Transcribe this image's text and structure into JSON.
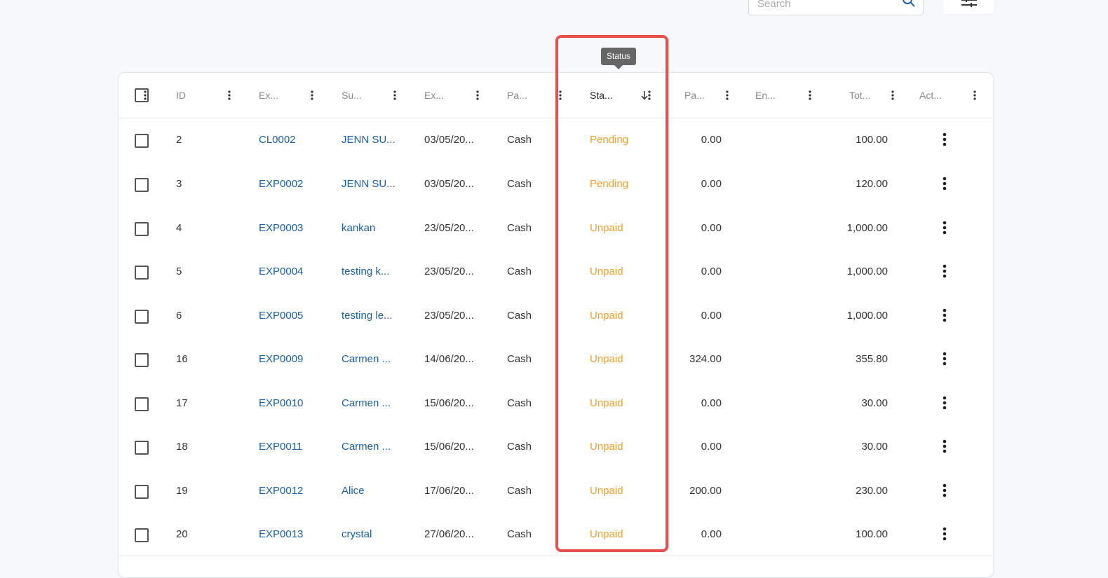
{
  "search": {
    "placeholder": "Search"
  },
  "tooltip": {
    "text": "Status"
  },
  "columns": [
    {
      "label": "ID"
    },
    {
      "label": "Ex..."
    },
    {
      "label": "Su..."
    },
    {
      "label": "Ex..."
    },
    {
      "label": "Pa..."
    },
    {
      "label": "Sta...",
      "sorted": "desc"
    },
    {
      "label": "Pa..."
    },
    {
      "label": "En..."
    },
    {
      "label": "Tot..."
    },
    {
      "label": "Act..."
    }
  ],
  "rows": [
    {
      "id": "2",
      "expense_no": "CL0002",
      "supplier": "JENN SU...",
      "date": "03/05/20...",
      "payment": "Cash",
      "status": "Pending",
      "paid": "0.00",
      "entity": "",
      "total": "100.00"
    },
    {
      "id": "3",
      "expense_no": "EXP0002",
      "supplier": "JENN SU...",
      "date": "03/05/20...",
      "payment": "Cash",
      "status": "Pending",
      "paid": "0.00",
      "entity": "",
      "total": "120.00"
    },
    {
      "id": "4",
      "expense_no": "EXP0003",
      "supplier": "kankan",
      "date": "23/05/20...",
      "payment": "Cash",
      "status": "Unpaid",
      "paid": "0.00",
      "entity": "",
      "total": "1,000.00"
    },
    {
      "id": "5",
      "expense_no": "EXP0004",
      "supplier": "testing k...",
      "date": "23/05/20...",
      "payment": "Cash",
      "status": "Unpaid",
      "paid": "0.00",
      "entity": "",
      "total": "1,000.00"
    },
    {
      "id": "6",
      "expense_no": "EXP0005",
      "supplier": "testing le...",
      "date": "23/05/20...",
      "payment": "Cash",
      "status": "Unpaid",
      "paid": "0.00",
      "entity": "",
      "total": "1,000.00"
    },
    {
      "id": "16",
      "expense_no": "EXP0009",
      "supplier": "Carmen ...",
      "date": "14/06/20...",
      "payment": "Cash",
      "status": "Unpaid",
      "paid": "324.00",
      "entity": "",
      "total": "355.80"
    },
    {
      "id": "17",
      "expense_no": "EXP0010",
      "supplier": "Carmen ...",
      "date": "15/06/20...",
      "payment": "Cash",
      "status": "Unpaid",
      "paid": "0.00",
      "entity": "",
      "total": "30.00"
    },
    {
      "id": "18",
      "expense_no": "EXP0011",
      "supplier": "Carmen ...",
      "date": "15/06/20...",
      "payment": "Cash",
      "status": "Unpaid",
      "paid": "0.00",
      "entity": "",
      "total": "30.00"
    },
    {
      "id": "19",
      "expense_no": "EXP0012",
      "supplier": "Alice",
      "date": "17/06/20...",
      "payment": "Cash",
      "status": "Unpaid",
      "paid": "200.00",
      "entity": "",
      "total": "230.00"
    },
    {
      "id": "20",
      "expense_no": "EXP0013",
      "supplier": "crystal",
      "date": "27/06/20...",
      "payment": "Cash",
      "status": "Unpaid",
      "paid": "0.00",
      "entity": "",
      "total": "100.00"
    }
  ],
  "colors": {
    "link": "#1a5fa8",
    "status": "#f0a22c",
    "highlight": "#e9504c"
  }
}
